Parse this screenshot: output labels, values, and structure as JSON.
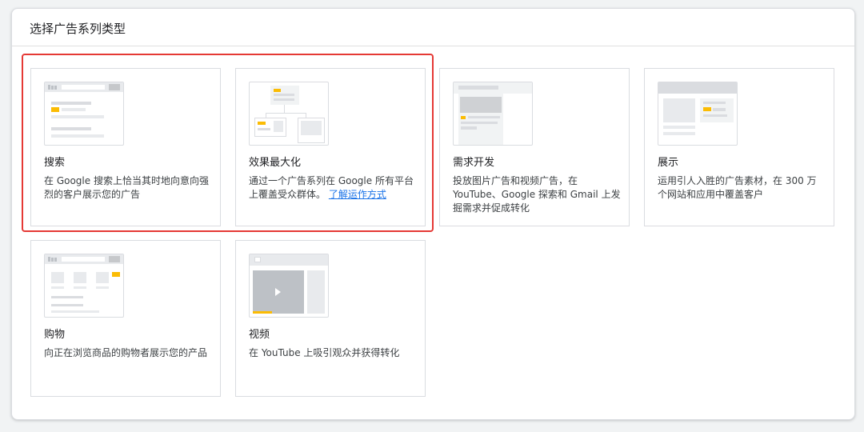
{
  "panel": {
    "title": "选择广告系列类型"
  },
  "cards": [
    {
      "id": "search",
      "name": "搜索",
      "description": "在 Google 搜索上恰当其时地向意向强烈的客户展示您的广告",
      "thumbnail_icon": "search-ad-thumbnail-icon"
    },
    {
      "id": "pmax",
      "name": "效果最大化",
      "description": "通过一个广告系列在 Google 所有平台上覆盖受众群体。",
      "link": "了解运作方式",
      "thumbnail_icon": "performance-max-thumbnail-icon"
    },
    {
      "id": "demand",
      "name": "需求开发",
      "description": "投放图片广告和视频广告，在 YouTube、Google 探索和 Gmail 上发掘需求并促成转化",
      "thumbnail_icon": "demand-gen-thumbnail-icon"
    },
    {
      "id": "display",
      "name": "展示",
      "description": "运用引人入胜的广告素材，在 300 万个网站和应用中覆盖客户",
      "thumbnail_icon": "display-ad-thumbnail-icon"
    },
    {
      "id": "shopping",
      "name": "购物",
      "description": "向正在浏览商品的购物者展示您的产品",
      "thumbnail_icon": "shopping-ad-thumbnail-icon"
    },
    {
      "id": "video",
      "name": "视频",
      "description": "在 YouTube 上吸引观众并获得转化",
      "thumbnail_icon": "video-ad-thumbnail-icon"
    }
  ],
  "colors": {
    "highlight": "#e53935",
    "accent": "#fbbc04",
    "link": "#1a73e8"
  }
}
